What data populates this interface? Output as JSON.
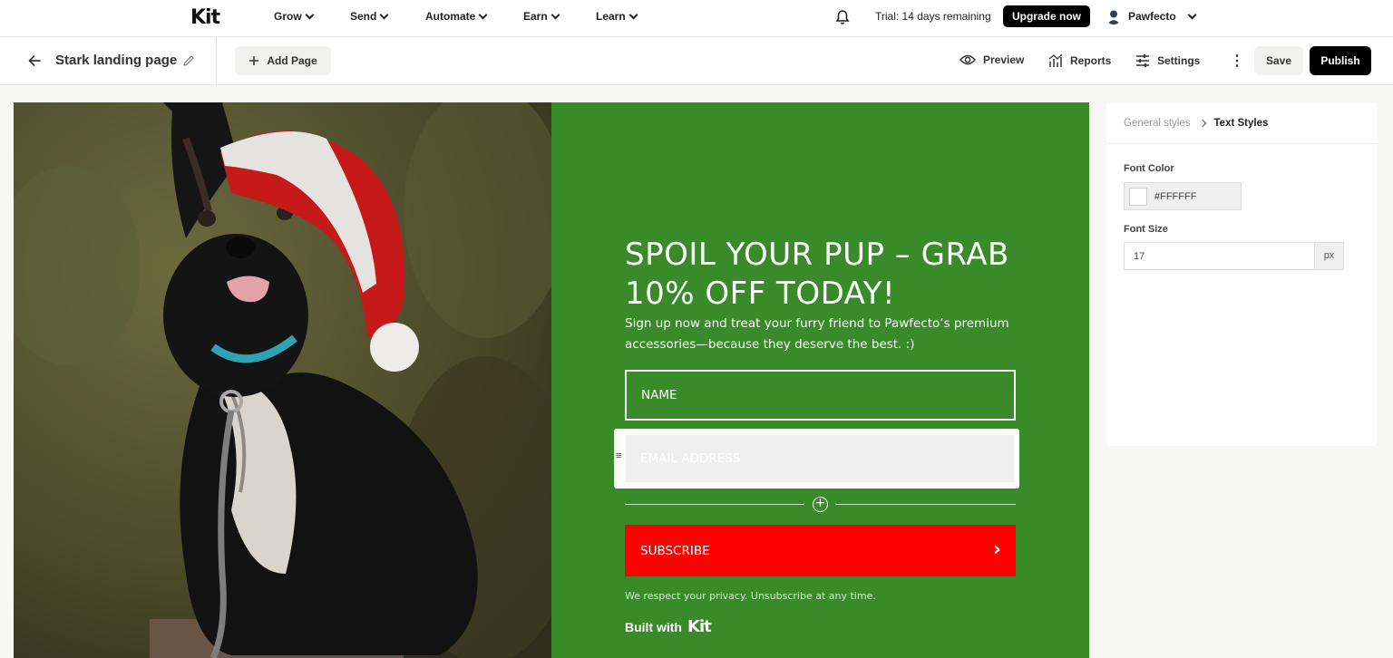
{
  "topnav": {
    "logo": "Kit",
    "items": [
      {
        "label": "Grow"
      },
      {
        "label": "Send"
      },
      {
        "label": "Automate"
      },
      {
        "label": "Earn"
      },
      {
        "label": "Learn"
      }
    ],
    "trial": "Trial: 14 days remaining",
    "upgrade_label": "Upgrade now",
    "user_name": "Pawfecto"
  },
  "toolbar": {
    "page_title": "Stark landing page",
    "add_page_label": "Add Page",
    "preview_label": "Preview",
    "reports_label": "Reports",
    "settings_label": "Settings",
    "save_label": "Save",
    "publish_label": "Publish"
  },
  "landing": {
    "headline": "SPOIL YOUR PUP – GRAB 10% OFF TODAY!",
    "subtext": "Sign up now and treat your furry friend to Pawfecto’s premium accessories—because they deserve the best. :)",
    "name_placeholder": "NAME",
    "email_placeholder": "EMAIL ADDRESS",
    "subscribe_label": "SUBSCRIBE",
    "privacy": "We respect your privacy. Unsubscribe at any time.",
    "built_with": "Built with",
    "built_with_brand": "Kit",
    "background_color": "#398B2A",
    "button_color": "#FF0000"
  },
  "panel": {
    "breadcrumb_general": "General styles",
    "breadcrumb_current": "Text Styles",
    "font_color_label": "Font Color",
    "font_color_value": "#FFFFFF",
    "font_size_label": "Font Size",
    "font_size_value": "17",
    "font_size_unit": "px"
  },
  "icons": [
    "bell-icon",
    "chevron-down-icon",
    "avatar",
    "back-arrow-icon",
    "pencil-icon",
    "plus-icon",
    "eye-icon",
    "bar-chart-icon",
    "sliders-icon",
    "more-vertical-icon",
    "drag-handle-icon",
    "add-circle-icon",
    "chevron-right-icon"
  ]
}
